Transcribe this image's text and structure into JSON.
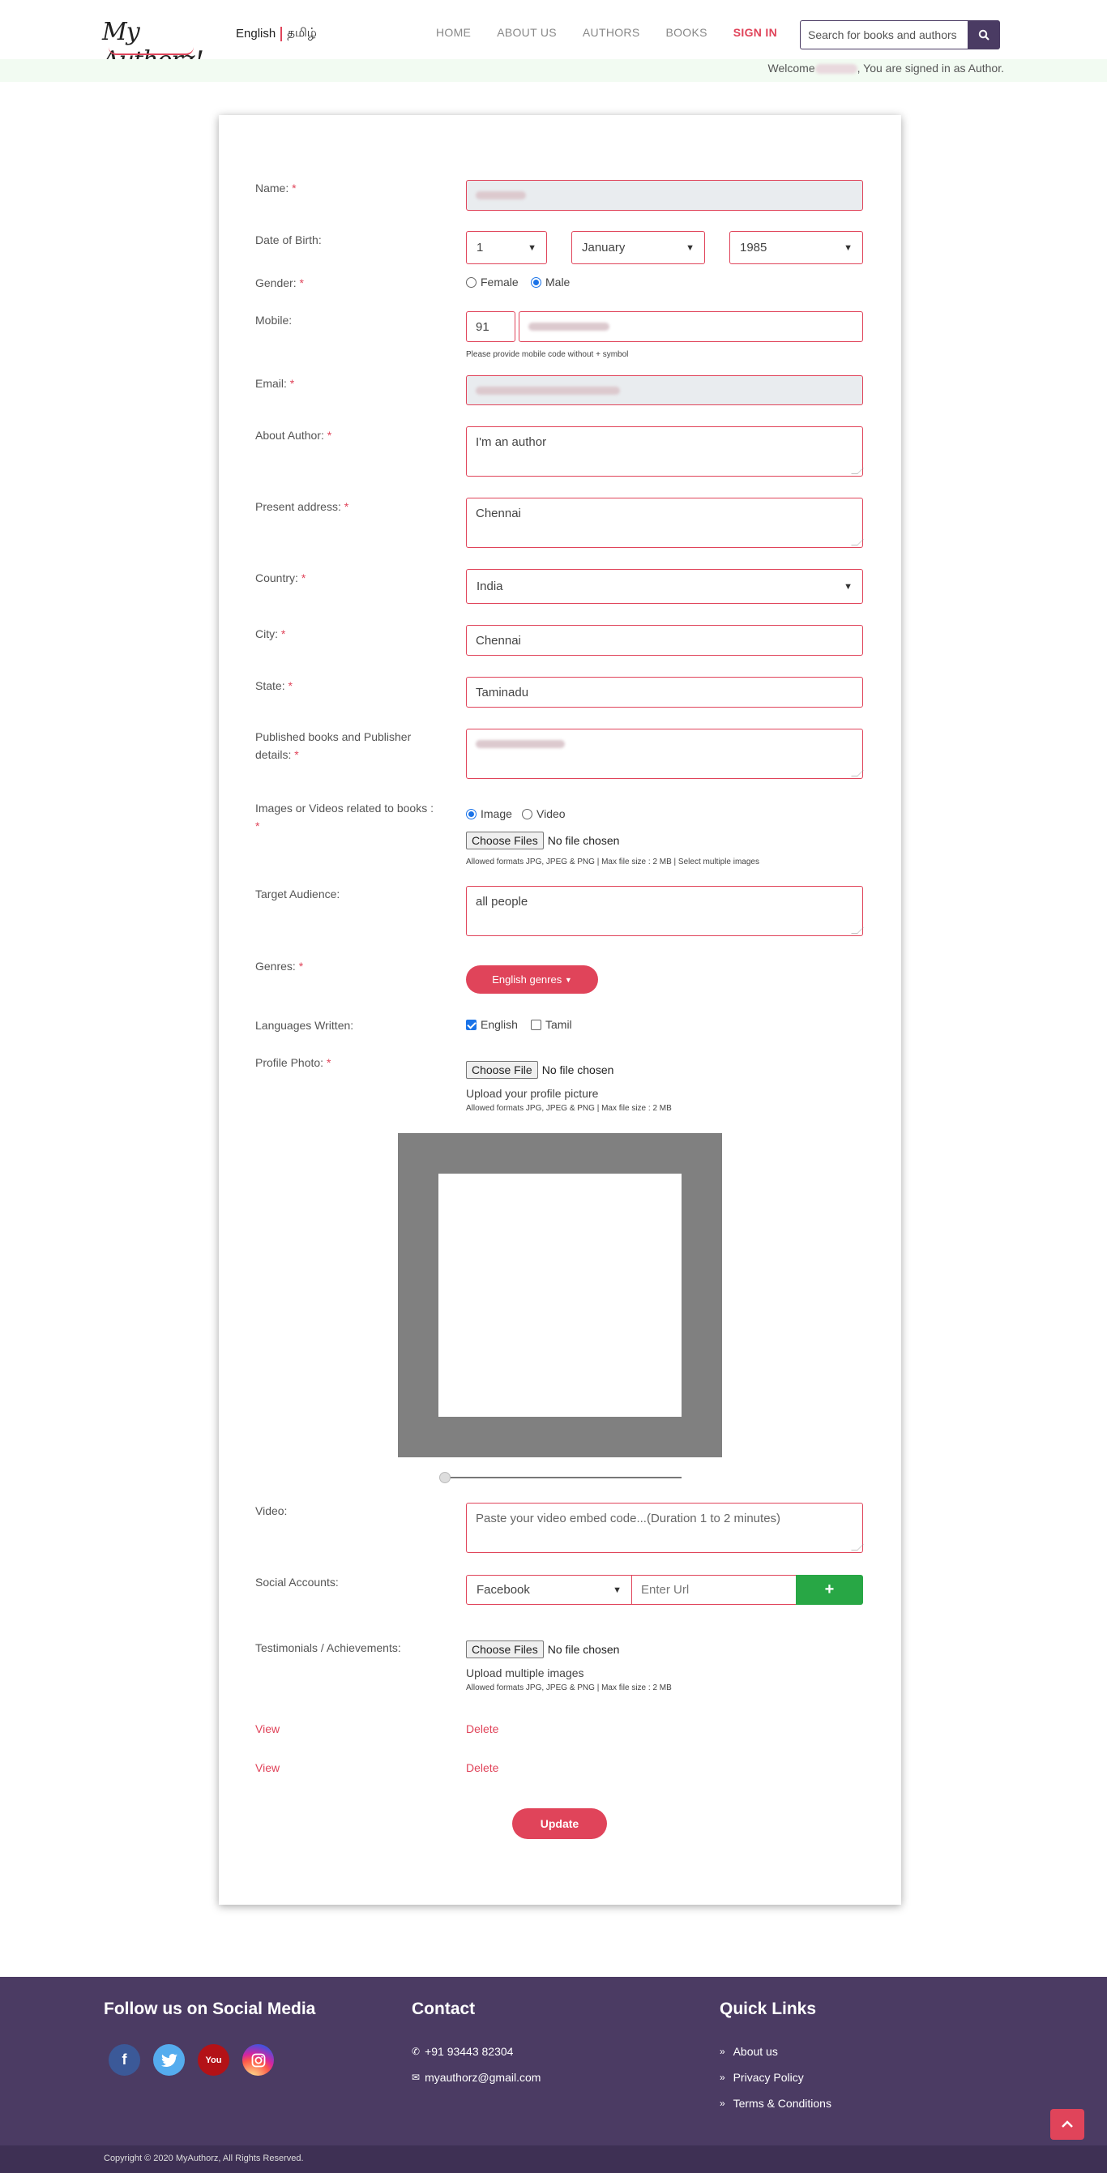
{
  "header": {
    "logo_text": "My Authorz!",
    "lang_english": "English",
    "lang_tamil": "தமிழ்",
    "nav": [
      "HOME",
      "ABOUT US",
      "AUTHORS",
      "BOOKS",
      "SIGN IN"
    ],
    "search_placeholder": "Search for books and authors",
    "welcome_prefix": "Welcome",
    "welcome_suffix": ", You are signed in as Author."
  },
  "form": {
    "name_label": "Name:",
    "dob_label": "Date of Birth:",
    "dob_day": "1",
    "dob_month": "January",
    "dob_year": "1985",
    "gender_label": "Gender:",
    "gender_female": "Female",
    "gender_male": "Male",
    "mobile_label": "Mobile:",
    "mobile_code": "91",
    "mobile_hint": "Please provide mobile code without + symbol",
    "email_label": "Email:",
    "about_label": "About Author:",
    "about_value": "I'm an author",
    "address_label": "Present address:",
    "address_value": "Chennai",
    "country_label": "Country:",
    "country_value": "India",
    "city_label": "City:",
    "city_value": "Chennai",
    "state_label": "State:",
    "state_value": "Taminadu",
    "published_label_1": "Published books and Publisher",
    "published_label_2": "details:",
    "media_label": "Images or Videos related to books :",
    "media_image": "Image",
    "media_video": "Video",
    "choose_files": "Choose Files",
    "choose_file": "Choose File",
    "no_file": "No file chosen",
    "media_hint": "Allowed formats JPG, JPEG & PNG | Max file size : 2 MB | Select multiple images",
    "audience_label": "Target Audience:",
    "audience_value": "all people",
    "genres_label": "Genres:",
    "genres_button": "English genres",
    "languages_label": "Languages Written:",
    "lang_english": "English",
    "lang_tamil": "Tamil",
    "photo_label": "Profile Photo:",
    "photo_upload_text": "Upload your profile picture",
    "photo_hint": "Allowed formats JPG, JPEG & PNG | Max file size : 2 MB",
    "video_label": "Video:",
    "video_placeholder": "Paste your video embed code...(Duration 1 to 2 minutes)",
    "social_label": "Social Accounts:",
    "social_select": "Facebook",
    "social_url_placeholder": "Enter Url",
    "social_add": "+",
    "testimonials_label": "Testimonials / Achievements:",
    "testimonials_upload_text": "Upload multiple images",
    "testimonials_hint": "Allowed formats JPG, JPEG & PNG | Max file size : 2 MB",
    "view": "View",
    "delete": "Delete",
    "update_button": "Update",
    "required_mark": "*"
  },
  "footer": {
    "social_title": "Follow us on Social Media",
    "contact_title": "Contact",
    "phone": "+91 93443 82304",
    "email": "myauthorz@gmail.com",
    "quick_title": "Quick Links",
    "quick_links": [
      "About us",
      "Privacy Policy",
      "Terms & Conditions"
    ],
    "copyright": "Copyright © 2020 MyAuthorz, All Rights Reserved."
  },
  "colors": {
    "accent": "#e0445a",
    "footer_bg": "#4b3b63",
    "add_green": "#28a745"
  }
}
